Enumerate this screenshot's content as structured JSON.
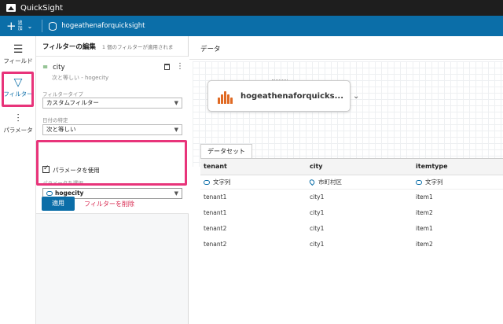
{
  "app": {
    "title": "QuickSight"
  },
  "toolbar": {
    "add_label": "追加",
    "dataset_name": "hogeathenaforquicksight"
  },
  "rail": {
    "items": [
      {
        "label": "フィールド",
        "icon": "list-icon"
      },
      {
        "label": "フィルター",
        "icon": "filter-icon"
      },
      {
        "label": "パラメータ",
        "icon": "sliders-icon"
      }
    ]
  },
  "filter_panel": {
    "title": "フィルターの編集",
    "subtitle": "1 個のフィルターが適用されま",
    "filter_name": "city",
    "filter_desc": "次と等しい - hogecity",
    "type_label": "フィルタータイプ",
    "type_value": "カスタムフィルター",
    "date_label": "日付の特定",
    "date_value": "次と等しい",
    "use_param_label": "パラメータを使用",
    "use_param_checked": true,
    "param_label": "パラメータを選択",
    "param_value": "hogecity",
    "apply_label": "適用",
    "delete_label": "フィルターを削除"
  },
  "main": {
    "header": "データ",
    "datasource_name": "hogeathenaforquicks...",
    "tab_label": "データセット",
    "table": {
      "columns": [
        "tenant",
        "city",
        "itemtype"
      ],
      "types": [
        "文字列",
        "市町村区",
        "文字列"
      ],
      "rows": [
        [
          "tenant1",
          "city1",
          "item1"
        ],
        [
          "tenant1",
          "city1",
          "item2"
        ],
        [
          "tenant2",
          "city1",
          "item1"
        ],
        [
          "tenant2",
          "city1",
          "item2"
        ]
      ]
    }
  },
  "colors": {
    "accent": "#0b6ea8",
    "highlight": "#e8347a",
    "danger": "#d8284f",
    "athena": "#e06a24"
  }
}
